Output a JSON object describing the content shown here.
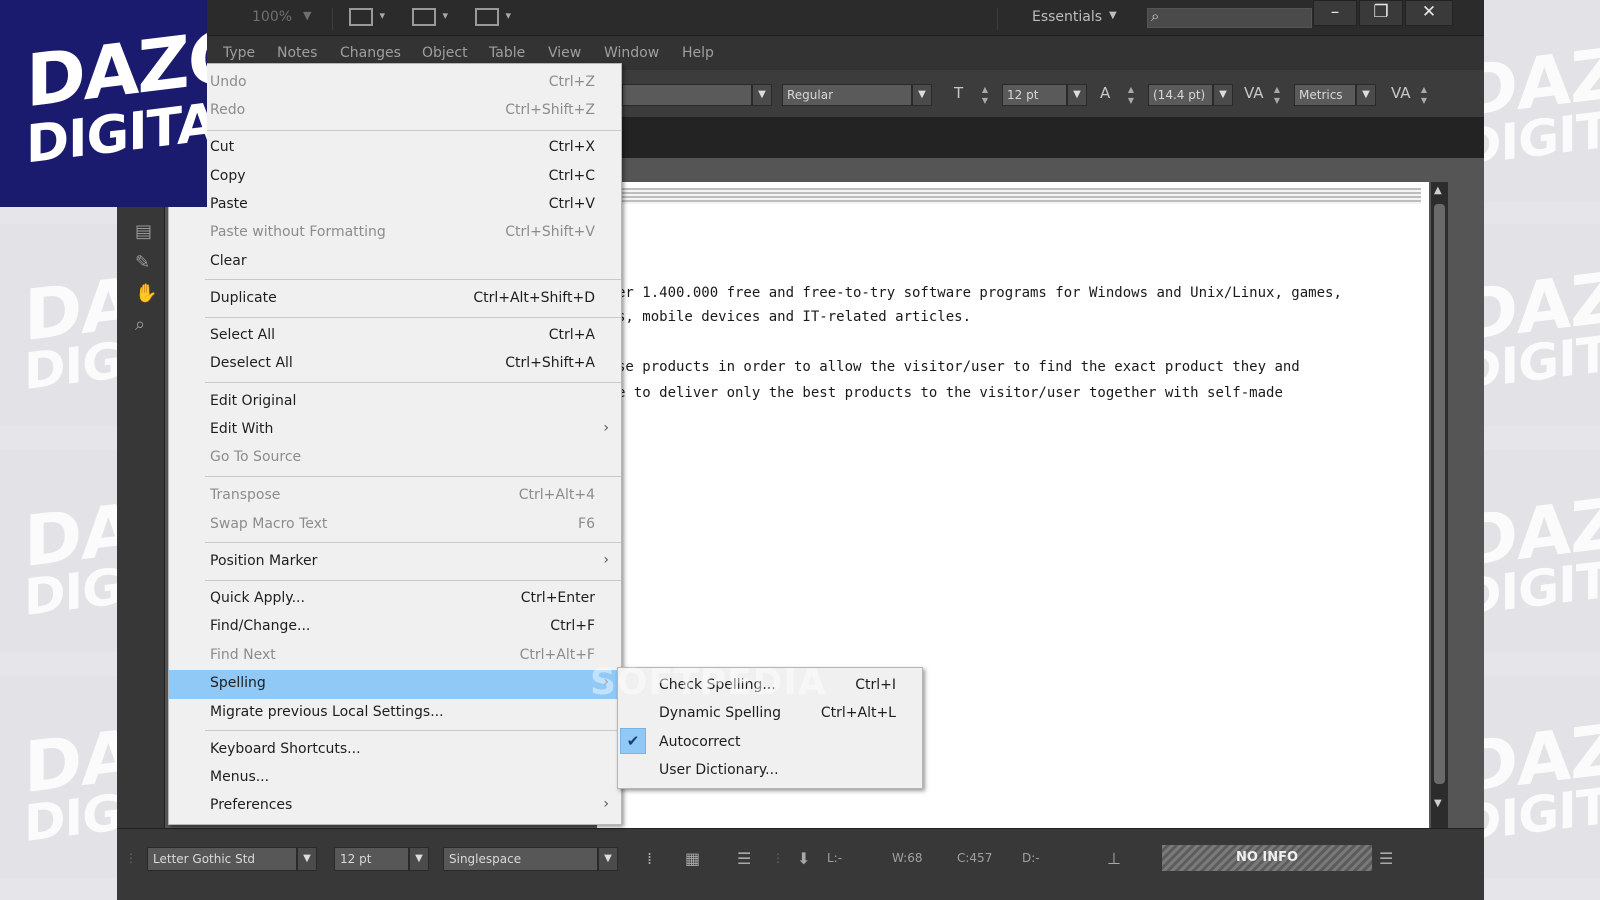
{
  "brand": {
    "logo_line1": "DAZG",
    "logo_line2": "DIGITAL",
    "logo_bg": "#1a1a6e"
  },
  "titlebar": {
    "zoom": "100%",
    "workspace": "Essentials",
    "search_icon": "search-icon",
    "window_buttons": [
      "minimize",
      "restore",
      "close"
    ]
  },
  "menubar": {
    "items": [
      "Type",
      "Notes",
      "Changes",
      "Object",
      "Table",
      "View",
      "Window",
      "Help"
    ]
  },
  "control_bar": {
    "font_style": "Regular",
    "font_size": "12 pt",
    "leading": "(14.4 pt)",
    "kerning": "Metrics"
  },
  "edit_menu": {
    "items": [
      {
        "label": "Undo",
        "shortcut": "Ctrl+Z",
        "disabled": true
      },
      {
        "label": "Redo",
        "shortcut": "Ctrl+Shift+Z",
        "disabled": true
      },
      {
        "label": "Cut",
        "shortcut": "Ctrl+X"
      },
      {
        "label": "Copy",
        "shortcut": "Ctrl+C"
      },
      {
        "label": "Paste",
        "shortcut": "Ctrl+V"
      },
      {
        "label": "Paste without Formatting",
        "shortcut": "Ctrl+Shift+V",
        "disabled": true
      },
      {
        "label": "Clear",
        "shortcut": ""
      },
      {
        "label": "Duplicate",
        "shortcut": "Ctrl+Alt+Shift+D"
      },
      {
        "label": "Select All",
        "shortcut": "Ctrl+A"
      },
      {
        "label": "Deselect All",
        "shortcut": "Ctrl+Shift+A"
      },
      {
        "label": "Edit Original",
        "shortcut": ""
      },
      {
        "label": "Edit With",
        "shortcut": "",
        "submenu": true
      },
      {
        "label": "Go To Source",
        "shortcut": "",
        "disabled": true
      },
      {
        "label": "Transpose",
        "shortcut": "Ctrl+Alt+4",
        "disabled": true
      },
      {
        "label": "Swap Macro Text",
        "shortcut": "F6",
        "disabled": true
      },
      {
        "label": "Position Marker",
        "shortcut": "",
        "submenu": true
      },
      {
        "label": "Quick Apply...",
        "shortcut": "Ctrl+Enter"
      },
      {
        "label": "Find/Change...",
        "shortcut": "Ctrl+F"
      },
      {
        "label": "Find Next",
        "shortcut": "Ctrl+Alt+F",
        "disabled": true
      },
      {
        "label": "Spelling",
        "shortcut": "",
        "submenu": true,
        "highlighted": true
      },
      {
        "label": "Migrate previous Local Settings...",
        "shortcut": ""
      },
      {
        "label": "Keyboard Shortcuts...",
        "shortcut": ""
      },
      {
        "label": "Menus...",
        "shortcut": ""
      },
      {
        "label": "Preferences",
        "shortcut": "",
        "submenu": true
      }
    ]
  },
  "spelling_submenu": {
    "items": [
      {
        "label": "Check Spelling...",
        "shortcut": "Ctrl+I"
      },
      {
        "label": "Dynamic Spelling",
        "shortcut": "Ctrl+Alt+L"
      },
      {
        "label": "Autocorrect",
        "shortcut": "",
        "checked": true
      },
      {
        "label": "User Dictionary...",
        "shortcut": ""
      }
    ],
    "check_mark": "✔"
  },
  "document": {
    "lines": [
      "er 1.400.000 free and free-to-try software programs for Windows and Unix/Linux, games,",
      "s, mobile devices and IT-related articles.",
      "se products in order to allow the visitor/user to find the exact product they and",
      "e to deliver only the best products to the visitor/user together with self-made"
    ],
    "watermark": "SOFTPEDIA"
  },
  "statusbar": {
    "font": "Letter Gothic Std",
    "size": "12 pt",
    "spacing": "Singlespace",
    "line_label": "L:-",
    "words": "W:68",
    "chars": "C:457",
    "depth": "D:-",
    "info": "NO INFO"
  }
}
